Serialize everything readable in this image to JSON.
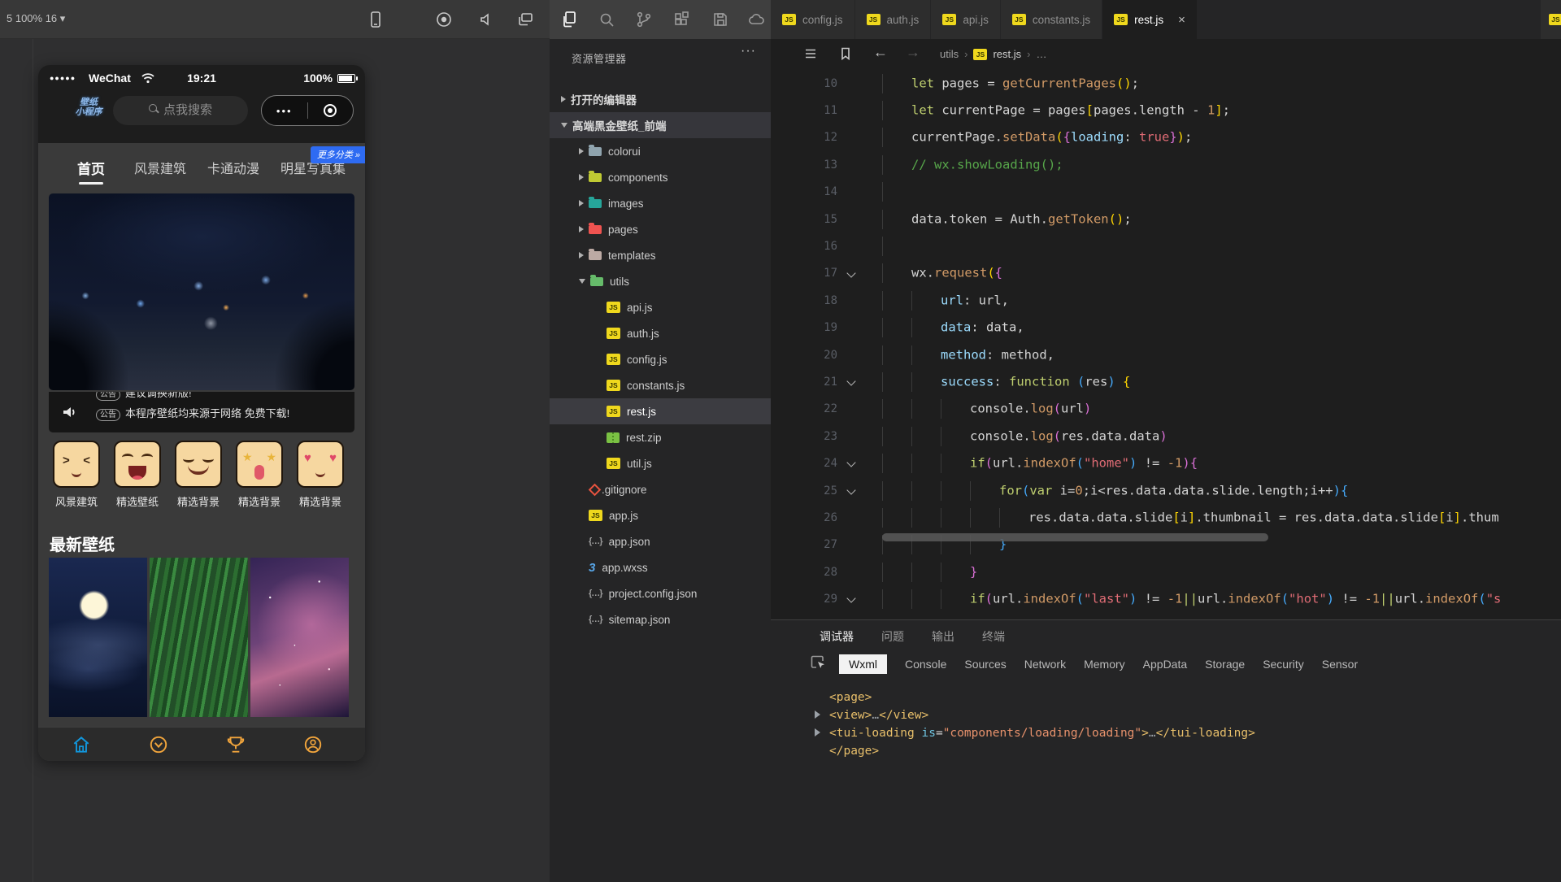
{
  "colors": {
    "accent_blue": "#1296db",
    "accent_orange": "#f0a43c",
    "js_badge": "#efd81d",
    "tab_active_bg": "#1e1e1e",
    "wxml_tag": "#e8bf6a"
  },
  "simulator": {
    "toolbar": {
      "device_label": "5 100% 16",
      "caret": "▾"
    },
    "phone": {
      "status": {
        "signal_dots": "●●●●●",
        "carrier": "WeChat",
        "time": "19:21",
        "battery_pct": "100%"
      },
      "logo": {
        "line1": "壁纸",
        "line2": "小程序"
      },
      "search": {
        "placeholder": "点我搜索"
      },
      "capsule": {
        "more_dots": "•••"
      },
      "nav_tabs": [
        {
          "label": "首页",
          "active": true
        },
        {
          "label": "风景建筑",
          "active": false
        },
        {
          "label": "卡通动漫",
          "active": false
        },
        {
          "label": "明星写真集",
          "active": false
        }
      ],
      "more_badge": "更多分类 »",
      "notice": {
        "badge": "公告",
        "line1": "建议调换新版!",
        "line2": "本程序壁纸均来源于网络 免费下载!"
      },
      "categories": [
        {
          "label": "风景建筑",
          "face": "wink"
        },
        {
          "label": "精选壁纸",
          "face": "laugh"
        },
        {
          "label": "精选背景",
          "face": "smug"
        },
        {
          "label": "精选背景",
          "face": "star"
        },
        {
          "label": "精选背景",
          "face": "heart"
        }
      ],
      "section_title": "最新壁纸",
      "bottom_nav": [
        {
          "label": "首页",
          "icon": "home",
          "active": true
        },
        {
          "label": "分类",
          "icon": "category",
          "active": false
        },
        {
          "label": "榜单",
          "icon": "rank",
          "active": false
        },
        {
          "label": "我的",
          "icon": "me",
          "active": false
        }
      ]
    }
  },
  "explorer": {
    "title": "资源管理器",
    "more": "···",
    "tree": [
      {
        "label": "打开的编辑器",
        "indent": 0,
        "chevron": "r",
        "kind": "section"
      },
      {
        "label": "高端黑金壁纸_前端",
        "indent": 0,
        "chevron": "d",
        "kind": "section",
        "highlight": true
      },
      {
        "label": "colorui",
        "indent": 1,
        "chevron": "r",
        "kind": "folder",
        "color": "#90a4ae"
      },
      {
        "label": "components",
        "indent": 1,
        "chevron": "r",
        "kind": "folder",
        "color": "#c0ca33"
      },
      {
        "label": "images",
        "indent": 1,
        "chevron": "r",
        "kind": "folder",
        "color": "#26a69a"
      },
      {
        "label": "pages",
        "indent": 1,
        "chevron": "r",
        "kind": "folder",
        "color": "#ef5350"
      },
      {
        "label": "templates",
        "indent": 1,
        "chevron": "r",
        "kind": "folder",
        "color": "#bcaaa4"
      },
      {
        "label": "utils",
        "indent": 1,
        "chevron": "d",
        "kind": "folder",
        "color": "#66bb6a"
      },
      {
        "label": "api.js",
        "indent": 2,
        "kind": "js"
      },
      {
        "label": "auth.js",
        "indent": 2,
        "kind": "js"
      },
      {
        "label": "config.js",
        "indent": 2,
        "kind": "js"
      },
      {
        "label": "constants.js",
        "indent": 2,
        "kind": "js"
      },
      {
        "label": "rest.js",
        "indent": 2,
        "kind": "js",
        "selected": true
      },
      {
        "label": "rest.zip",
        "indent": 2,
        "kind": "zip"
      },
      {
        "label": "util.js",
        "indent": 2,
        "kind": "js"
      },
      {
        "label": ".gitignore",
        "indent": 1,
        "kind": "git"
      },
      {
        "label": "app.js",
        "indent": 1,
        "kind": "js"
      },
      {
        "label": "app.json",
        "indent": 1,
        "kind": "json"
      },
      {
        "label": "app.wxss",
        "indent": 1,
        "kind": "wxss"
      },
      {
        "label": "project.config.json",
        "indent": 1,
        "kind": "json"
      },
      {
        "label": "sitemap.json",
        "indent": 1,
        "kind": "json"
      }
    ]
  },
  "editor": {
    "tabs": [
      {
        "label": "config.js",
        "active": false
      },
      {
        "label": "auth.js",
        "active": false
      },
      {
        "label": "api.js",
        "active": false
      },
      {
        "label": "constants.js",
        "active": false
      },
      {
        "label": "rest.js",
        "active": true,
        "close": "×"
      }
    ],
    "breadcrumb": {
      "segments": [
        "utils",
        "rest.js",
        "…"
      ]
    },
    "code_lines": [
      {
        "num": 10,
        "indent": 1,
        "tokens": [
          [
            "kw",
            "let"
          ],
          [
            "pl",
            " pages = "
          ],
          [
            "fn",
            "getCurrentPages"
          ],
          [
            "br1",
            "()"
          ],
          [
            "pl",
            ";"
          ]
        ]
      },
      {
        "num": 11,
        "indent": 1,
        "tokens": [
          [
            "kw",
            "let"
          ],
          [
            "pl",
            " currentPage = pages"
          ],
          [
            "br1",
            "["
          ],
          [
            "pl",
            "pages.length - "
          ],
          [
            "nu",
            "1"
          ],
          [
            "br1",
            "]"
          ],
          [
            "pl",
            ";"
          ]
        ]
      },
      {
        "num": 12,
        "indent": 1,
        "tokens": [
          [
            "pl",
            "currentPage."
          ],
          [
            "fn",
            "setData"
          ],
          [
            "br1",
            "("
          ],
          [
            "br2",
            "{"
          ],
          [
            "pr",
            "loading"
          ],
          [
            "pl",
            ": "
          ],
          [
            "bo",
            "true"
          ],
          [
            "br2",
            "}"
          ],
          [
            "br1",
            ")"
          ],
          [
            "pl",
            ";"
          ]
        ]
      },
      {
        "num": 13,
        "indent": 1,
        "tokens": [
          [
            "cm",
            "// wx.showLoading();"
          ]
        ]
      },
      {
        "num": 14,
        "indent": 1,
        "tokens": []
      },
      {
        "num": 15,
        "indent": 1,
        "tokens": [
          [
            "pl",
            "data.token = Auth."
          ],
          [
            "fn",
            "getToken"
          ],
          [
            "br1",
            "()"
          ],
          [
            "pl",
            ";"
          ]
        ]
      },
      {
        "num": 16,
        "indent": 1,
        "tokens": []
      },
      {
        "num": 17,
        "indent": 1,
        "fold": true,
        "tokens": [
          [
            "pl",
            "wx."
          ],
          [
            "fn",
            "request"
          ],
          [
            "br1",
            "("
          ],
          [
            "br2",
            "{"
          ]
        ]
      },
      {
        "num": 18,
        "indent": 2,
        "tokens": [
          [
            "pr",
            "url"
          ],
          [
            "pl",
            ": url,"
          ]
        ]
      },
      {
        "num": 19,
        "indent": 2,
        "tokens": [
          [
            "pr",
            "data"
          ],
          [
            "pl",
            ": data,"
          ]
        ]
      },
      {
        "num": 20,
        "indent": 2,
        "tokens": [
          [
            "pr",
            "method"
          ],
          [
            "pl",
            ": method,"
          ]
        ]
      },
      {
        "num": 21,
        "indent": 2,
        "fold": true,
        "tokens": [
          [
            "pr",
            "success"
          ],
          [
            "pl",
            ": "
          ],
          [
            "kw",
            "function"
          ],
          [
            "pl",
            " "
          ],
          [
            "br3",
            "("
          ],
          [
            "pl",
            "res"
          ],
          [
            "br3",
            ")"
          ],
          [
            "pl",
            " "
          ],
          [
            "br1",
            "{"
          ]
        ]
      },
      {
        "num": 22,
        "indent": 3,
        "tokens": [
          [
            "pl",
            "console."
          ],
          [
            "fn",
            "log"
          ],
          [
            "br2",
            "("
          ],
          [
            "pl",
            "url"
          ],
          [
            "br2",
            ")"
          ]
        ]
      },
      {
        "num": 23,
        "indent": 3,
        "tokens": [
          [
            "pl",
            "console."
          ],
          [
            "fn",
            "log"
          ],
          [
            "br2",
            "("
          ],
          [
            "pl",
            "res.data.data"
          ],
          [
            "br2",
            ")"
          ]
        ]
      },
      {
        "num": 24,
        "indent": 3,
        "fold": true,
        "tokens": [
          [
            "kw",
            "if"
          ],
          [
            "br2",
            "("
          ],
          [
            "pl",
            "url."
          ],
          [
            "fn",
            "indexOf"
          ],
          [
            "br3",
            "("
          ],
          [
            "st",
            "\"home\""
          ],
          [
            "br3",
            ")"
          ],
          [
            "pl",
            " != "
          ],
          [
            "nu",
            "-1"
          ],
          [
            "br2",
            ")"
          ],
          [
            "br2",
            "{"
          ]
        ]
      },
      {
        "num": 25,
        "indent": 4,
        "fold": true,
        "tokens": [
          [
            "kw",
            "for"
          ],
          [
            "br3",
            "("
          ],
          [
            "kw",
            "var"
          ],
          [
            "pl",
            " i="
          ],
          [
            "nu",
            "0"
          ],
          [
            "pl",
            ";i<res.data.data.slide.length;i++"
          ],
          [
            "br3",
            ")"
          ],
          [
            "br3",
            "{"
          ]
        ]
      },
      {
        "num": 26,
        "indent": 5,
        "tokens": [
          [
            "pl",
            "res.data.data.slide"
          ],
          [
            "br1",
            "["
          ],
          [
            "pl",
            "i"
          ],
          [
            "br1",
            "]"
          ],
          [
            "pl",
            ".thumbnail = res.data.data.slide"
          ],
          [
            "br1",
            "["
          ],
          [
            "pl",
            "i"
          ],
          [
            "br1",
            "]"
          ],
          [
            "pl",
            ".thum"
          ]
        ]
      },
      {
        "num": 27,
        "indent": 4,
        "tokens": [
          [
            "br3",
            "}"
          ]
        ]
      },
      {
        "num": 28,
        "indent": 3,
        "tokens": [
          [
            "br2",
            "}"
          ]
        ]
      },
      {
        "num": 29,
        "indent": 3,
        "fold": true,
        "tokens": [
          [
            "kw",
            "if"
          ],
          [
            "br2",
            "("
          ],
          [
            "pl",
            "url."
          ],
          [
            "fn",
            "indexOf"
          ],
          [
            "br3",
            "("
          ],
          [
            "st",
            "\"last\""
          ],
          [
            "br3",
            ")"
          ],
          [
            "pl",
            " != "
          ],
          [
            "nu",
            "-1"
          ],
          [
            "op",
            "||"
          ],
          [
            "pl",
            "url."
          ],
          [
            "fn",
            "indexOf"
          ],
          [
            "br3",
            "("
          ],
          [
            "st",
            "\"hot\""
          ],
          [
            "br3",
            ")"
          ],
          [
            "pl",
            " != "
          ],
          [
            "nu",
            "-1"
          ],
          [
            "op",
            "||"
          ],
          [
            "pl",
            "url."
          ],
          [
            "fn",
            "indexOf"
          ],
          [
            "br3",
            "("
          ],
          [
            "st",
            "\"s"
          ]
        ]
      }
    ]
  },
  "debug": {
    "panel_tabs": [
      {
        "label": "调试器",
        "active": true
      },
      {
        "label": "问题",
        "active": false
      },
      {
        "label": "输出",
        "active": false
      },
      {
        "label": "终端",
        "active": false
      }
    ],
    "inspector_tabs": [
      {
        "label": "Wxml",
        "active": true
      },
      {
        "label": "Console",
        "active": false
      },
      {
        "label": "Sources",
        "active": false
      },
      {
        "label": "Network",
        "active": false
      },
      {
        "label": "Memory",
        "active": false
      },
      {
        "label": "AppData",
        "active": false
      },
      {
        "label": "Storage",
        "active": false
      },
      {
        "label": "Security",
        "active": false
      },
      {
        "label": "Sensor",
        "active": false
      }
    ],
    "wxml_tree": [
      {
        "arrow": false,
        "tokens": [
          [
            "tag",
            "<page>"
          ]
        ]
      },
      {
        "arrow": true,
        "tokens": [
          [
            "tag",
            "<view>"
          ],
          [
            "dim",
            "…"
          ],
          [
            "tag",
            "</view>"
          ]
        ]
      },
      {
        "arrow": true,
        "tokens": [
          [
            "tag",
            "<tui-loading"
          ],
          [
            "pl",
            " "
          ],
          [
            "attr",
            "is"
          ],
          [
            "pl",
            "="
          ],
          [
            "val",
            "\"components/loading/loading\""
          ],
          [
            "tag",
            ">"
          ],
          [
            "dim",
            "…"
          ],
          [
            "tag",
            "</tui-loading>"
          ]
        ]
      },
      {
        "arrow": false,
        "tokens": [
          [
            "tag",
            "</page>"
          ]
        ]
      }
    ]
  }
}
